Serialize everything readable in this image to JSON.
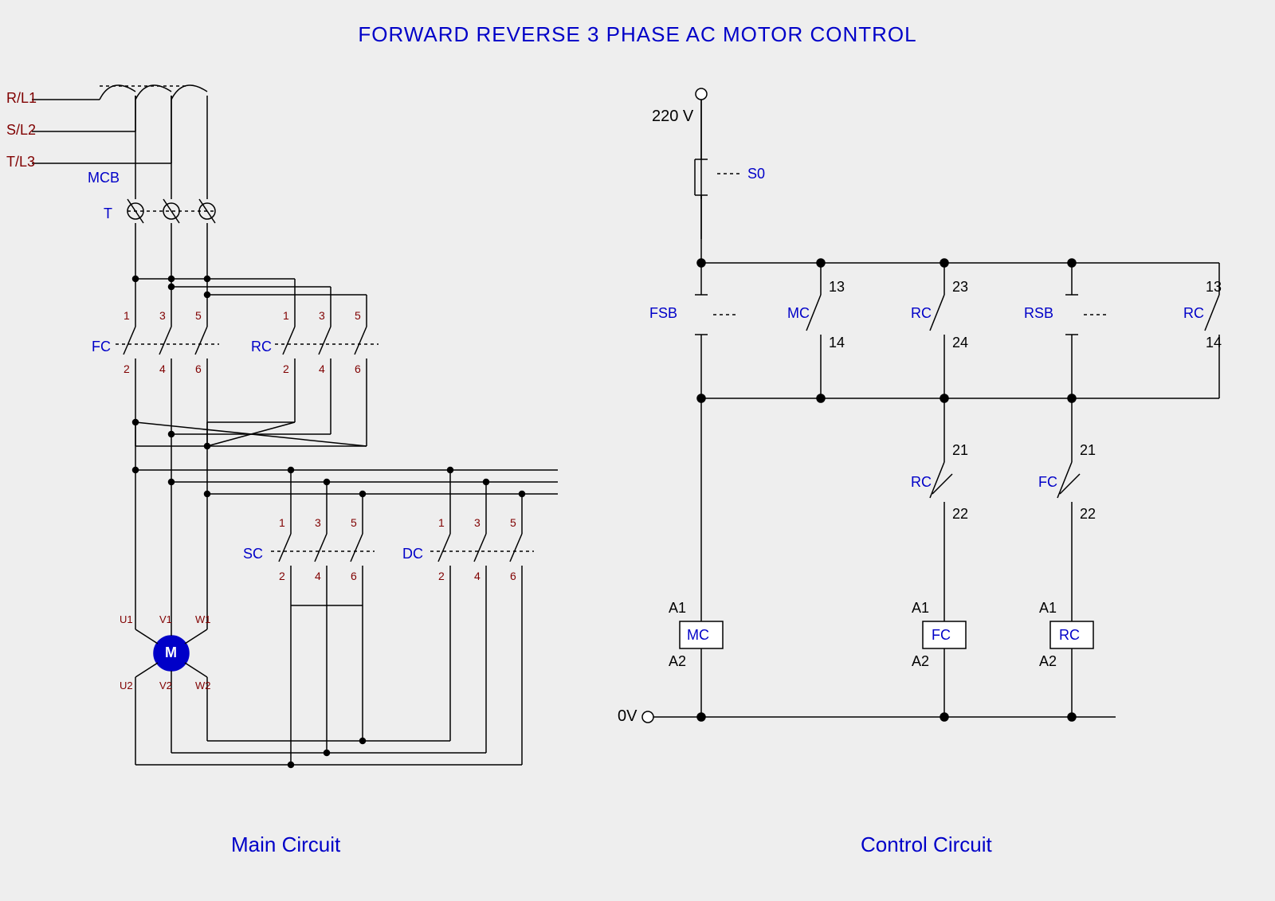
{
  "title": "FORWARD REVERSE 3 PHASE AC MOTOR CONTROL",
  "main": {
    "caption": "Main Circuit",
    "phases": [
      "R/L1",
      "S/L2",
      "T/L3"
    ],
    "mcb": "MCB",
    "transformer": "T",
    "fc": "FC",
    "rc": "RC",
    "sc": "SC",
    "dc": "DC",
    "motor": "M",
    "fc_nums": [
      "1",
      "3",
      "5",
      "2",
      "4",
      "6"
    ],
    "rc_nums": [
      "1",
      "3",
      "5",
      "2",
      "4",
      "6"
    ],
    "sc_nums": [
      "1",
      "3",
      "5",
      "2",
      "4",
      "6"
    ],
    "dc_nums": [
      "1",
      "3",
      "5",
      "2",
      "4",
      "6"
    ],
    "motor_top": [
      "U1",
      "V1",
      "W1"
    ],
    "motor_bot": [
      "U2",
      "V2",
      "W2"
    ]
  },
  "control": {
    "caption": "Control Circuit",
    "v220": "220 V",
    "v0": "0V",
    "s0": "S0",
    "fsb": "FSB",
    "rsb": "RSB",
    "mc": "MC",
    "rc": "RC",
    "fc": "FC",
    "a1": "A1",
    "a2": "A2",
    "num_13": "13",
    "num_14": "14",
    "num_21": "21",
    "num_22": "22",
    "num_23": "23",
    "num_24": "24"
  }
}
